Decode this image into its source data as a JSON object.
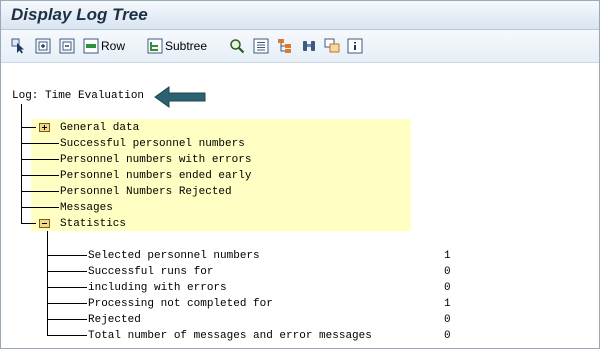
{
  "window": {
    "title": "Display Log Tree"
  },
  "toolbar": {
    "row_label": "Row",
    "subtree_label": "Subtree"
  },
  "tree": {
    "root": "Log: Time Evaluation",
    "nodes": [
      "General data",
      "Successful personnel numbers",
      "Personnel numbers with errors",
      "Personnel numbers ended early",
      "Personnel Numbers Rejected",
      "Messages",
      "Statistics"
    ],
    "statistics": [
      {
        "label": "Selected personnel numbers",
        "value": "1"
      },
      {
        "label": "Successful runs for",
        "value": "0"
      },
      {
        "label": "including with errors",
        "value": "0"
      },
      {
        "label": "Processing not completed for",
        "value": "1"
      },
      {
        "label": "Rejected",
        "value": "0"
      },
      {
        "label": "Total number of messages and error messages",
        "value": "0"
      }
    ]
  },
  "colors": {
    "highlight": "#ffffc4",
    "arrow": "#2b6170"
  }
}
